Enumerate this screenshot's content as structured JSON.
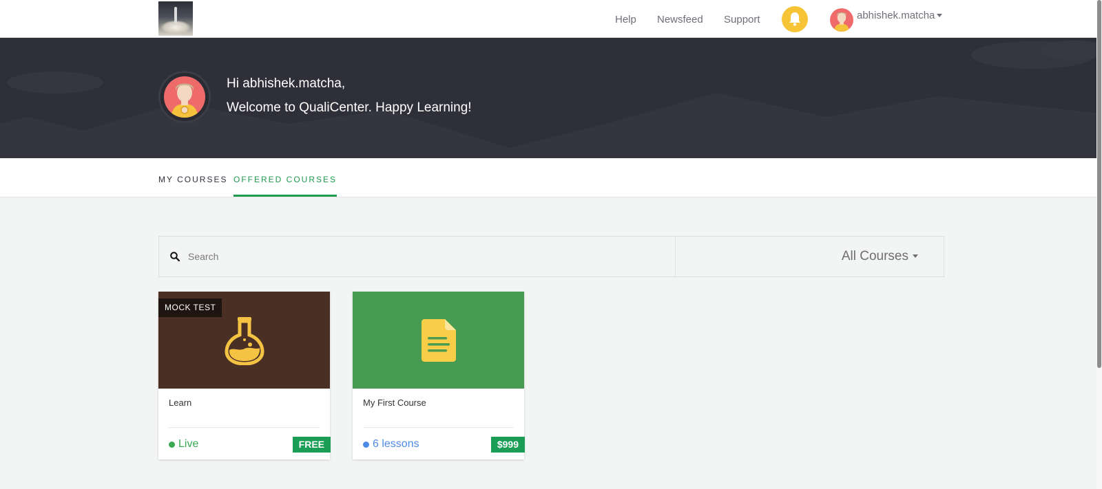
{
  "nav": {
    "links": [
      "Help",
      "Newsfeed",
      "Support"
    ],
    "username": "abhishek.matcha"
  },
  "hero": {
    "greeting": "Hi abhishek.matcha,",
    "welcome": "Welcome to QualiCenter. Happy Learning!"
  },
  "tabs": [
    {
      "label": "MY COURSES",
      "active": false
    },
    {
      "label": "OFFERED COURSES",
      "active": true
    }
  ],
  "search": {
    "placeholder": "Search",
    "value": "",
    "filter_label": "All Courses"
  },
  "courses": [
    {
      "title": "Learn",
      "badge": "MOCK TEST",
      "icon": "flask-icon",
      "thumb_color": "#4a3024",
      "status": "Live",
      "status_color": "#3aaa55",
      "price": "FREE",
      "price_color": "#1a9e55"
    },
    {
      "title": "My First Course",
      "badge": "",
      "icon": "document-icon",
      "thumb_color": "#479a52",
      "status": "6 lessons",
      "status_color": "#4c8ae8",
      "price": "$999",
      "price_color": "#1a9e55"
    }
  ],
  "colors": {
    "accent": "#1f9a4f",
    "hero_bg": "#2f2f39",
    "bell": "#f7c437",
    "avatar": "#ef6b6b"
  }
}
